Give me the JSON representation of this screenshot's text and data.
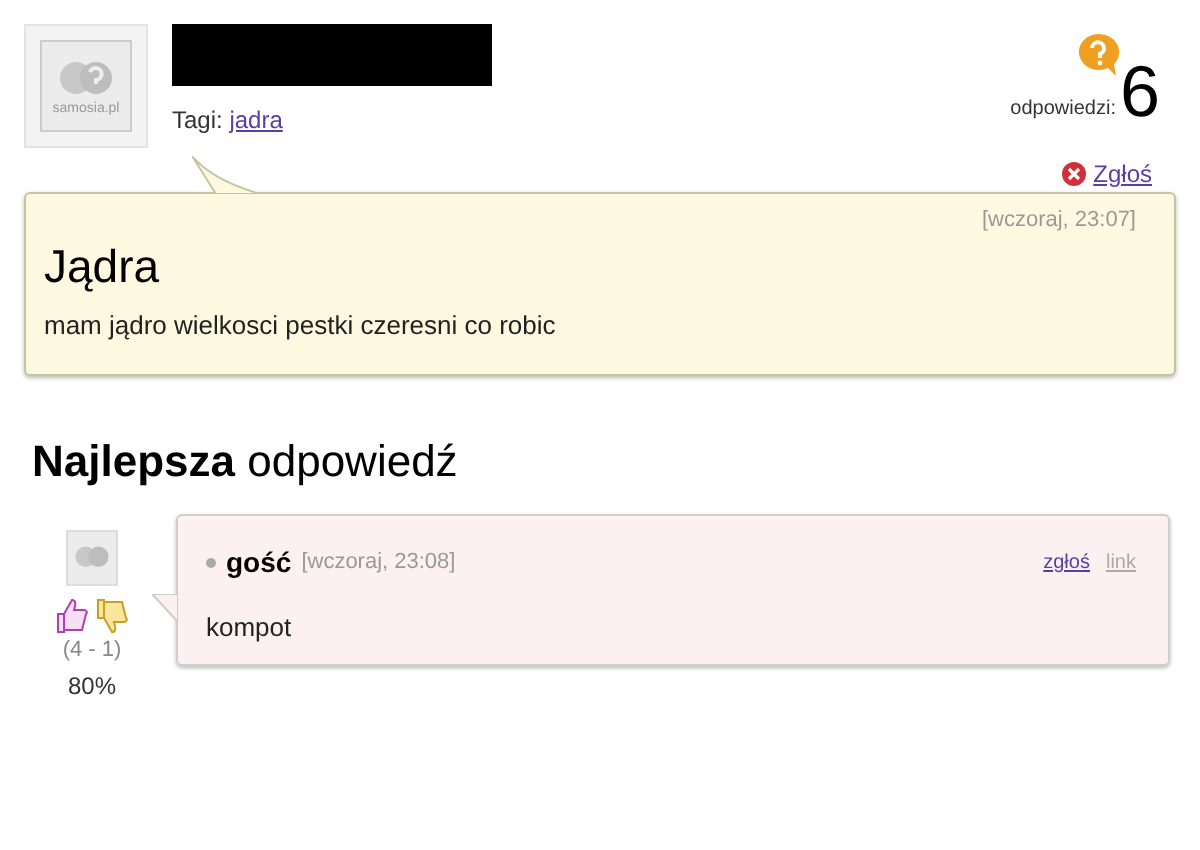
{
  "question": {
    "avatar_label": "samosia.pl",
    "tags_label": "Tagi:",
    "tags": [
      "jadra"
    ],
    "answers_label": "odpowiedzi:",
    "answers_count": "6",
    "report": "Zgłoś",
    "timestamp": "[wczoraj, 23:07]",
    "title": "Jądra",
    "body": "mam jądro wielkosci pestki czeresni co robic"
  },
  "best_answer": {
    "heading": "**Najlepsza** odpowiedź",
    "author": "gość",
    "timestamp": "[wczoraj, 23:08]",
    "report": "zgłoś",
    "link": "link",
    "body": "kompot",
    "votes": "(4 - 1)",
    "percent": "80%"
  }
}
